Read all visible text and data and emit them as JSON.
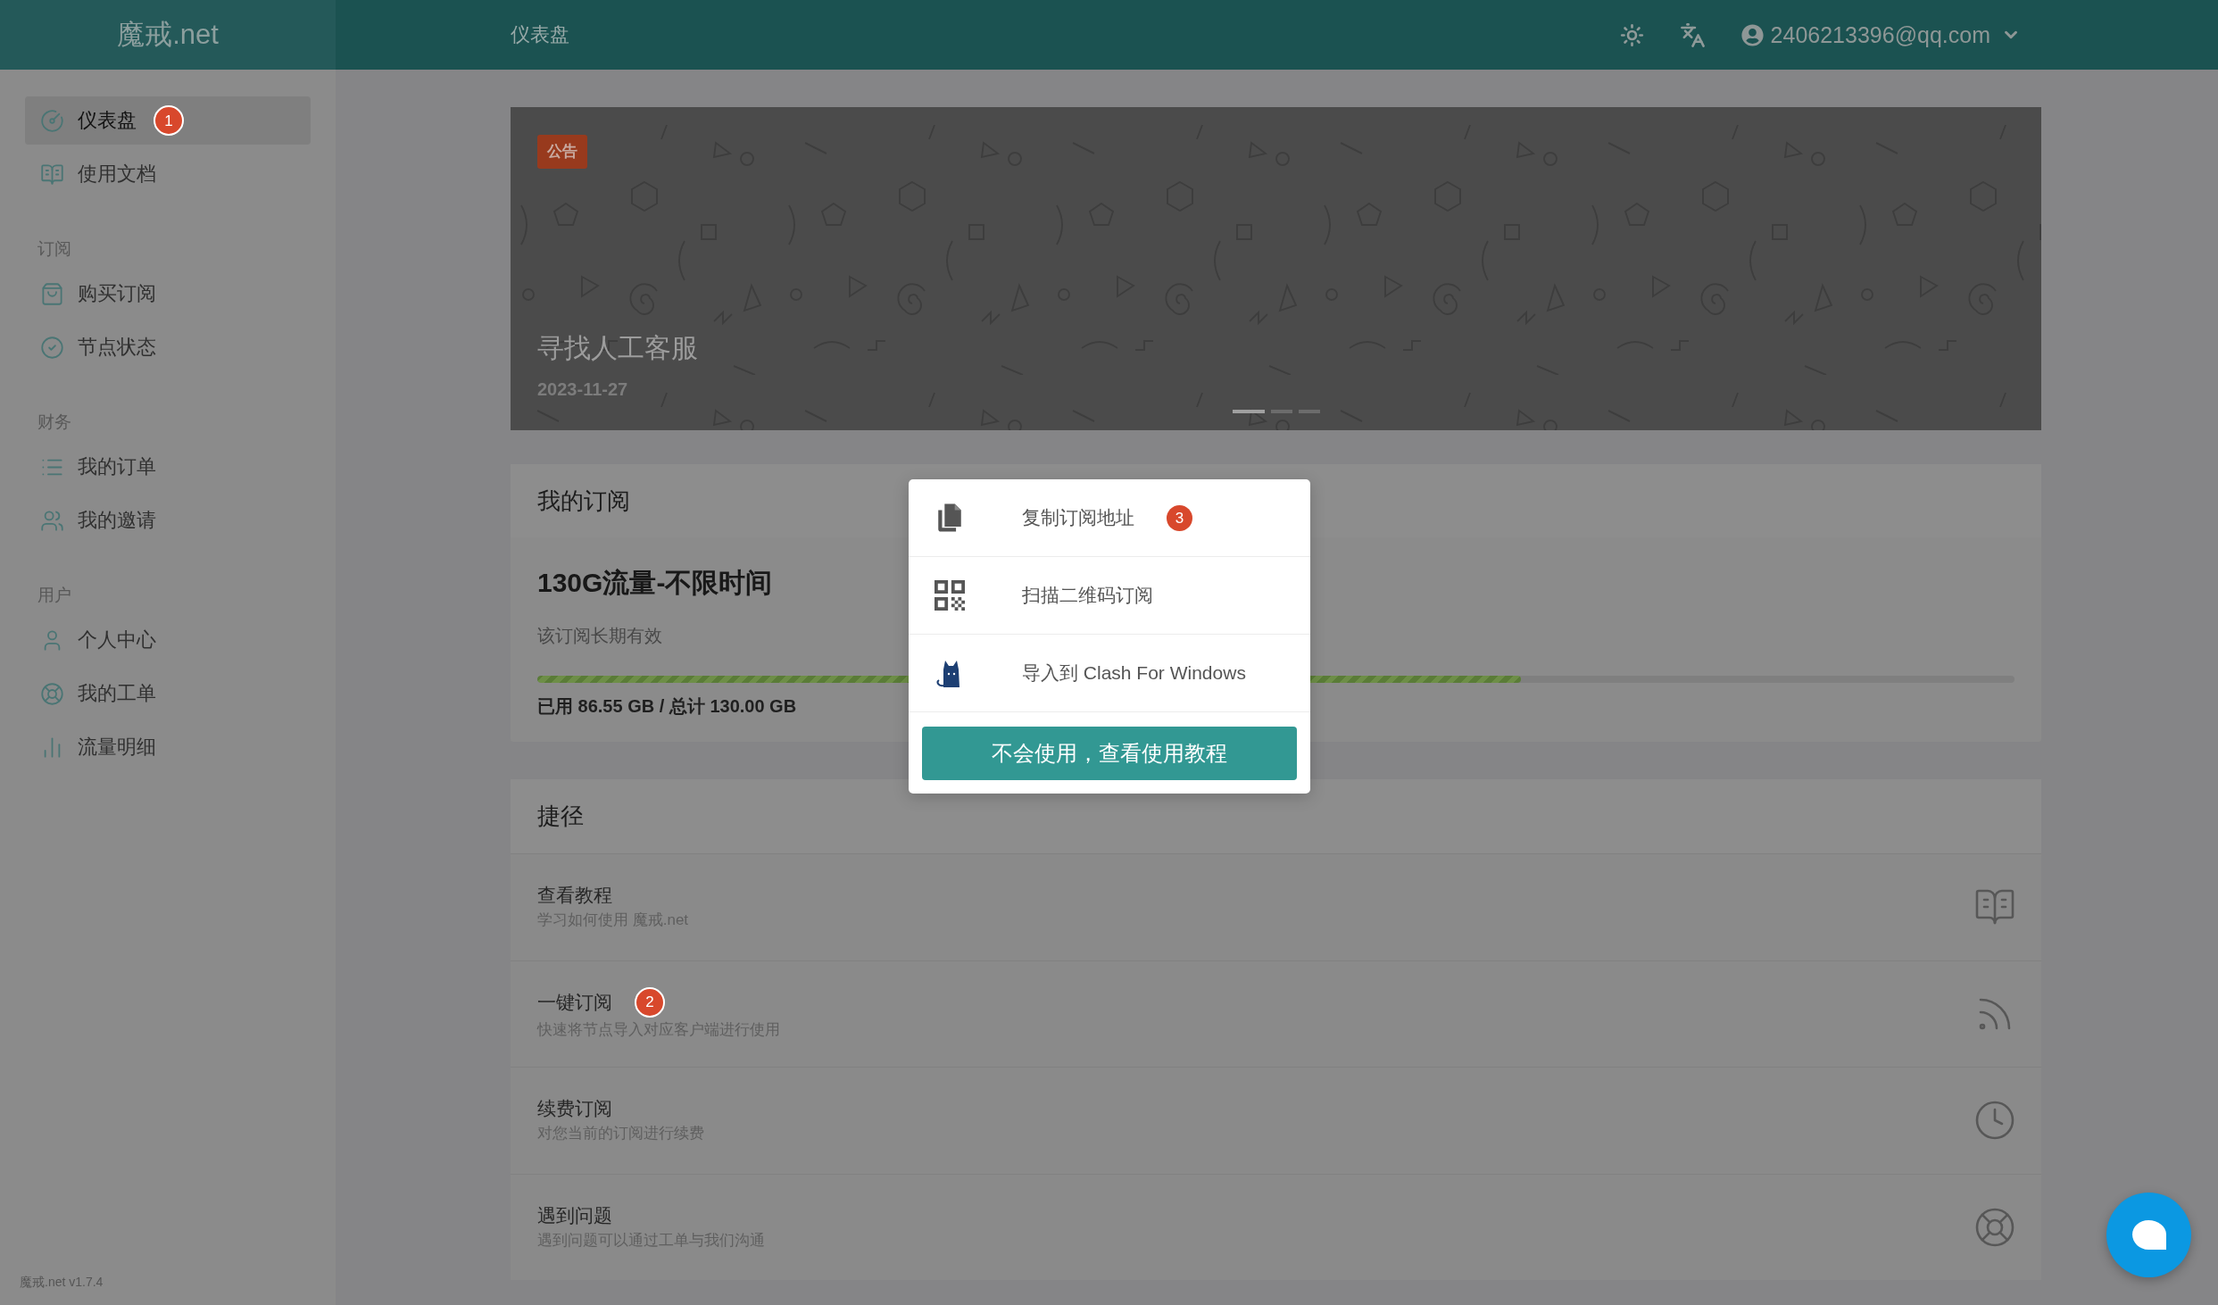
{
  "sidebar": {
    "logo": "魔戒.net",
    "sections": [
      {
        "items": [
          {
            "label": "仪表盘",
            "selected": true,
            "badge": "1"
          },
          {
            "label": "使用文档",
            "selected": false
          }
        ]
      },
      {
        "heading": "订阅",
        "items": [
          {
            "label": "购买订阅",
            "selected": false
          },
          {
            "label": "节点状态",
            "selected": false
          }
        ]
      },
      {
        "heading": "财务",
        "items": [
          {
            "label": "我的订单",
            "selected": false
          },
          {
            "label": "我的邀请",
            "selected": false
          }
        ]
      },
      {
        "heading": "用户",
        "items": [
          {
            "label": "个人中心",
            "selected": false
          },
          {
            "label": "我的工单",
            "selected": false
          },
          {
            "label": "流量明细",
            "selected": false
          }
        ]
      }
    ],
    "version": "魔戒.net v1.7.4"
  },
  "header": {
    "title": "仪表盘",
    "user_email": "2406213396@qq.com"
  },
  "banner": {
    "tag": "公告",
    "title": "寻找人工客服",
    "date": "2023-11-27",
    "slides": [
      {
        "selected": true
      },
      {
        "selected": false
      },
      {
        "selected": false
      }
    ]
  },
  "subscription": {
    "heading": "我的订阅",
    "plan": "130G流量-不限时间",
    "validity": "该订阅长期有效",
    "usage": {
      "level": 0.6658,
      "reading": "已用 86.55 GB / 总计 130.00 GB"
    }
  },
  "shortcuts": {
    "heading": "捷径",
    "items": [
      {
        "title": "查看教程",
        "description": "学习如何使用 魔戒.net"
      },
      {
        "title": "一键订阅",
        "description": "快速将节点导入对应客户端进行使用",
        "badge": "2"
      },
      {
        "title": "续费订阅",
        "description": "对您当前的订阅进行续费"
      },
      {
        "title": "遇到问题",
        "description": "遇到问题可以通过工单与我们沟通"
      }
    ]
  },
  "subscribe_menu": {
    "items": [
      {
        "label": "复制订阅地址",
        "badge": "3"
      },
      {
        "label": "扫描二维码订阅"
      },
      {
        "label": "导入到 Clash For Windows"
      }
    ],
    "button": "不会使用，查看使用教程"
  }
}
